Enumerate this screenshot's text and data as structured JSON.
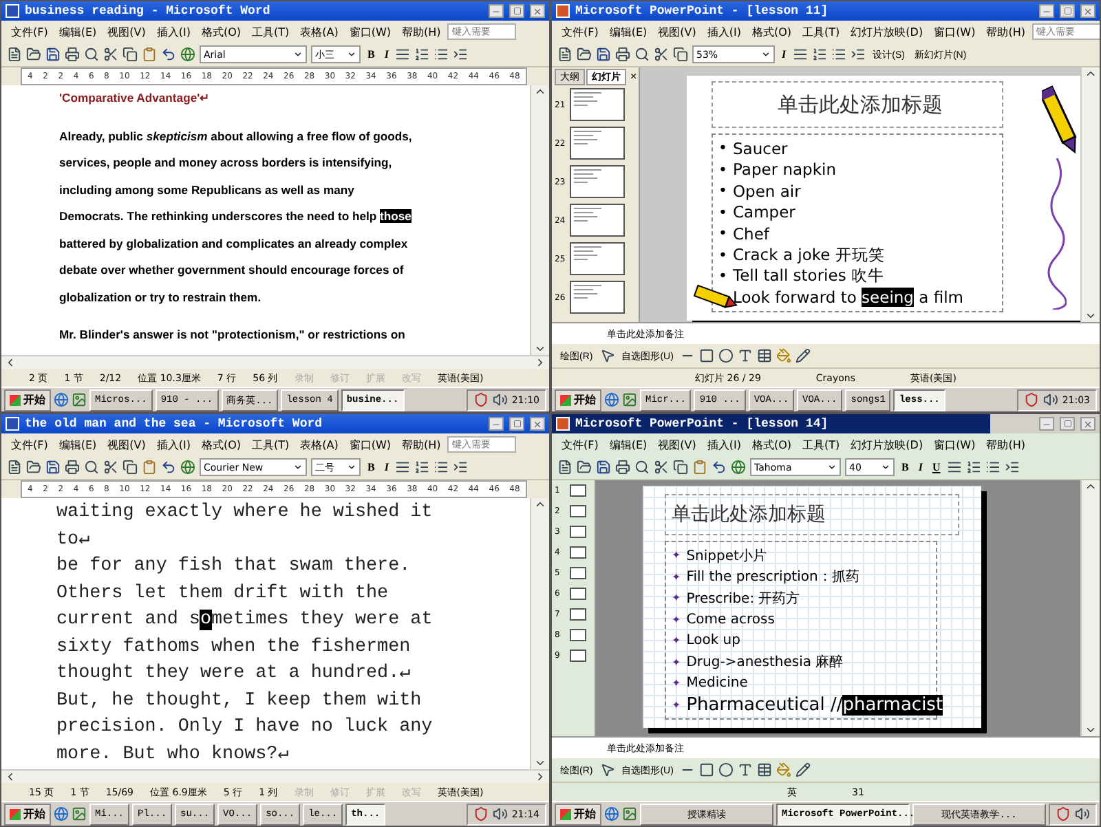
{
  "windows": [
    {
      "kind": "word",
      "title": "business reading - Microsoft Word",
      "menus": [
        "文件(F)",
        "编辑(E)",
        "视图(V)",
        "插入(I)",
        "格式(O)",
        "工具(T)",
        "表格(A)",
        "窗口(W)",
        "帮助(H)"
      ],
      "help_placeholder": "键入需要",
      "font": "Arial",
      "font_size": "小三",
      "format_buttons": [
        "B",
        "I"
      ],
      "ruler": [
        "4",
        "2",
        "2",
        "4",
        "6",
        "8",
        "10",
        "12",
        "14",
        "16",
        "18",
        "20",
        "22",
        "24",
        "26",
        "28",
        "30",
        "32",
        "34",
        "36",
        "38",
        "40",
        "42",
        "44",
        "46",
        "48"
      ],
      "document": {
        "paragraphs": [
          {
            "kind": "heading",
            "lines": [
              {
                "parts": [
                  {
                    "text": "'Comparative Advantage'↵",
                    "selected": false
                  }
                ]
              }
            ]
          },
          {
            "kind": "body",
            "lines": [
              {
                "parts": [
                  {
                    "text": "Already, public *skepticism* about allowing a free flow of goods,",
                    "selected": false
                  }
                ]
              },
              {
                "parts": [
                  {
                    "text": "services, people and money across borders is intensifying,",
                    "selected": false
                  }
                ]
              },
              {
                "parts": [
                  {
                    "text": "including among some Republicans as well as many",
                    "selected": false
                  }
                ]
              },
              {
                "parts": [
                  {
                    "text": "Democrats. The rethinking underscores the need to help ",
                    "selected": false
                  },
                  {
                    "text": "those",
                    "selected": true
                  }
                ]
              },
              {
                "parts": [
                  {
                    "text": "battered by globalization and complicates an already complex",
                    "selected": false
                  }
                ]
              },
              {
                "parts": [
                  {
                    "text": "debate over whether government should encourage forces of",
                    "selected": false
                  }
                ]
              },
              {
                "parts": [
                  {
                    "text": "globalization or try to restrain them.",
                    "selected": false
                  }
                ]
              }
            ]
          },
          {
            "kind": "body",
            "lines": [
              {
                "parts": [
                  {
                    "text": "Mr. Blinder's answer is not \"protectionism,\" or restrictions on",
                    "selected": false
                  }
                ]
              }
            ]
          }
        ]
      },
      "status": [
        {
          "text": "2 页",
          "disabled": false
        },
        {
          "text": "1 节",
          "disabled": false
        },
        {
          "text": "2/12",
          "disabled": false
        },
        {
          "text": "位置 10.3厘米",
          "disabled": false
        },
        {
          "text": "7 行",
          "disabled": false
        },
        {
          "text": "56 列",
          "disabled": false
        },
        {
          "text": "录制",
          "disabled": true
        },
        {
          "text": "修订",
          "disabled": true
        },
        {
          "text": "扩展",
          "disabled": true
        },
        {
          "text": "改写",
          "disabled": true
        },
        {
          "text": "英语(美国)",
          "disabled": false
        }
      ],
      "taskbar": {
        "start": "开始",
        "items": [
          {
            "label": "Micros...",
            "selected": false
          },
          {
            "label": "910 - ...",
            "selected": false
          },
          {
            "label": "商务英...",
            "selected": false
          },
          {
            "label": "lesson 4",
            "selected": false
          },
          {
            "label": "busine...",
            "selected": true
          }
        ],
        "clock": "21:10"
      }
    },
    {
      "kind": "powerpoint",
      "title": "Microsoft PowerPoint - [lesson 11]",
      "menus": [
        "文件(F)",
        "编辑(E)",
        "视图(V)",
        "插入(I)",
        "格式(O)",
        "工具(T)",
        "幻灯片放映(D)",
        "窗口(W)",
        "帮助(H)"
      ],
      "help_placeholder": "键入需要",
      "zoom": "53%",
      "format_buttons": [
        "I"
      ],
      "toolbar_buttons": [
        "设计(S)",
        "新幻灯片(N)"
      ],
      "tabs": [
        {
          "label": "大纲",
          "selected": false
        },
        {
          "label": "幻灯片",
          "selected": true
        }
      ],
      "tab_close": "×",
      "thumbnails": [
        "21",
        "22",
        "23",
        "24",
        "25",
        "26"
      ],
      "slide": {
        "title": "单击此处添加标题",
        "bullet": "•",
        "bullets": [
          {
            "parts": [
              {
                "text": "Saucer",
                "selected": false
              }
            ]
          },
          {
            "parts": [
              {
                "text": "Paper napkin",
                "selected": false
              }
            ]
          },
          {
            "parts": [
              {
                "text": "Open air",
                "selected": false
              }
            ]
          },
          {
            "parts": [
              {
                "text": "Camper",
                "selected": false
              }
            ]
          },
          {
            "parts": [
              {
                "text": "Chef",
                "selected": false
              }
            ]
          },
          {
            "parts": [
              {
                "text": "Crack a joke 开玩笑",
                "selected": false
              }
            ]
          },
          {
            "parts": [
              {
                "text": "Tell tall stories 吹牛",
                "selected": false
              }
            ]
          },
          {
            "parts": [
              {
                "text": "Look forward to ",
                "selected": false
              },
              {
                "text": "seeing",
                "selected": true
              },
              {
                "text": " a film",
                "selected": false
              }
            ]
          }
        ]
      },
      "notes": "单击此处添加备注",
      "draw_menu": "绘图(R)",
      "autoshapes_menu": "自选图形(U)",
      "status": [
        {
          "text": "幻灯片 26 / 29",
          "disabled": false
        },
        {
          "text": "Crayons",
          "disabled": false
        },
        {
          "text": "英语(美国)",
          "disabled": false
        }
      ],
      "taskbar": {
        "start": "开始",
        "items": [
          {
            "label": "Micr...",
            "selected": false
          },
          {
            "label": "910 ...",
            "selected": false
          },
          {
            "label": "VOA...",
            "selected": false
          },
          {
            "label": "VOA...",
            "selected": false
          },
          {
            "label": "songs1",
            "selected": false
          },
          {
            "label": "less...",
            "selected": true
          }
        ],
        "clock": "21:03"
      }
    },
    {
      "kind": "word",
      "title": "the old man and the sea - Microsoft Word",
      "menus": [
        "文件(F)",
        "编辑(E)",
        "视图(V)",
        "插入(I)",
        "格式(O)",
        "工具(T)",
        "表格(A)",
        "窗口(W)",
        "帮助(H)"
      ],
      "help_placeholder": "键入需要",
      "font": "Courier New",
      "font_size": "二号",
      "format_buttons": [
        "B",
        "I"
      ],
      "ruler": [
        "4",
        "2",
        "2",
        "4",
        "6",
        "8",
        "10",
        "12",
        "14",
        "16",
        "18",
        "20",
        "22",
        "24",
        "26",
        "28",
        "30",
        "32",
        "34",
        "36",
        "38",
        "40",
        "42",
        "44",
        "46",
        "48"
      ],
      "document": {
        "paragraphs": [
          {
            "kind": "body",
            "lines": [
              {
                "parts": [
                  {
                    "text": "waiting exactly where he wished it",
                    "selected": false
                  }
                ]
              },
              {
                "parts": [
                  {
                    "text": "to↵",
                    "selected": false
                  }
                ]
              },
              {
                "parts": [
                  {
                    "text": "be for any fish that swam there.",
                    "selected": false
                  }
                ]
              },
              {
                "parts": [
                  {
                    "text": "Others let them drift with the",
                    "selected": false
                  }
                ]
              },
              {
                "parts": [
                  {
                    "text": "current and s",
                    "selected": false
                  },
                  {
                    "text": "o",
                    "selected": true
                  },
                  {
                    "text": "metimes they were at",
                    "selected": false
                  }
                ]
              },
              {
                "parts": [
                  {
                    "text": "sixty fathoms when the fishermen",
                    "selected": false
                  }
                ]
              },
              {
                "parts": [
                  {
                    "text": "thought they were at a hundred.↵",
                    "selected": false
                  }
                ]
              },
              {
                "parts": [
                  {
                    "text": "But, he thought, I keep them with",
                    "selected": false
                  }
                ]
              },
              {
                "parts": [
                  {
                    "text": "precision. Only I have no luck any",
                    "selected": false
                  }
                ]
              },
              {
                "parts": [
                  {
                    "text": "more. But who knows?↵",
                    "selected": false
                  }
                ]
              }
            ]
          }
        ]
      },
      "status": [
        {
          "text": "15 页",
          "disabled": false
        },
        {
          "text": "1 节",
          "disabled": false
        },
        {
          "text": "15/69",
          "disabled": false
        },
        {
          "text": "位置 6.9厘米",
          "disabled": false
        },
        {
          "text": "5 行",
          "disabled": false
        },
        {
          "text": "1 列",
          "disabled": false
        },
        {
          "text": "录制",
          "disabled": true
        },
        {
          "text": "修订",
          "disabled": true
        },
        {
          "text": "扩展",
          "disabled": true
        },
        {
          "text": "改写",
          "disabled": true
        },
        {
          "text": "英语(美国)",
          "disabled": false
        }
      ],
      "taskbar": {
        "start": "开始",
        "items": [
          {
            "label": "Mi...",
            "selected": false
          },
          {
            "label": "Pl...",
            "selected": false
          },
          {
            "label": "su...",
            "selected": false
          },
          {
            "label": "VO...",
            "selected": false
          },
          {
            "label": "so...",
            "selected": false
          },
          {
            "label": "le...",
            "selected": false
          },
          {
            "label": "th...",
            "selected": true
          }
        ],
        "clock": "21:14"
      }
    },
    {
      "kind": "powerpoint",
      "title": "Microsoft PowerPoint - [lesson 14]",
      "menus": [
        "文件(F)",
        "编辑(E)",
        "视图(V)",
        "插入(I)",
        "格式(O)",
        "工具(T)",
        "幻灯片放映(D)",
        "窗口(W)",
        "帮助(H)"
      ],
      "font": "Tahoma",
      "font_size": "40",
      "format_buttons": [
        "B",
        "I",
        "U"
      ],
      "thumbnails": [
        "1",
        "2",
        "3",
        "4",
        "5",
        "6",
        "7",
        "8",
        "9"
      ],
      "slide": {
        "title": "单击此处添加标题",
        "bullet": "✦",
        "bullets": [
          {
            "parts": [
              {
                "text": "Snippet小片",
                "selected": false
              }
            ]
          },
          {
            "parts": [
              {
                "text": "Fill the prescription：抓药",
                "selected": false
              }
            ]
          },
          {
            "parts": [
              {
                "text": "Prescribe: 开药方",
                "selected": false
              }
            ]
          },
          {
            "parts": [
              {
                "text": "Come across",
                "selected": false
              }
            ]
          },
          {
            "parts": [
              {
                "text": "Look up",
                "selected": false
              }
            ]
          },
          {
            "parts": [
              {
                "text": "Drug->anesthesia 麻醉",
                "selected": false
              }
            ]
          },
          {
            "parts": [
              {
                "text": "Medicine",
                "selected": false
              }
            ]
          },
          {
            "parts": [
              {
                "text": "Pharmaceutical //",
                "selected": false
              },
              {
                "text": "pharmacist",
                "selected": true
              }
            ]
          }
        ]
      },
      "notes": "单击此处添加备注",
      "draw_menu": "绘图(R)",
      "autoshapes_menu": "自选图形(U)",
      "status": [
        {
          "text": "英",
          "disabled": false
        },
        {
          "text": "31",
          "disabled": false
        }
      ],
      "taskbar": {
        "start": "开始",
        "items": [
          {
            "label": "授课精读",
            "selected": false
          },
          {
            "label": "Microsoft PowerPoint...",
            "selected": true
          },
          {
            "label": "现代英语教学...",
            "selected": false
          }
        ]
      }
    }
  ]
}
